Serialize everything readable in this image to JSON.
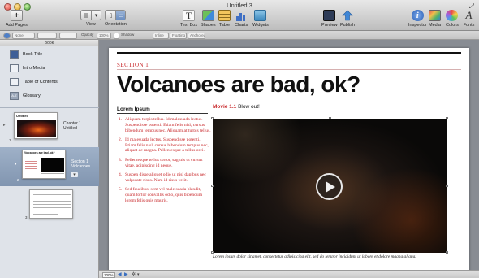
{
  "window": {
    "title": "Untitled 3"
  },
  "toolbar": {
    "add_pages": "Add Pages",
    "view": "View",
    "orientation": "Orientation",
    "text_box": "Text Box",
    "shapes": "Shapes",
    "table": "Table",
    "charts": "Charts",
    "widgets": "Widgets",
    "preview": "Preview",
    "publish": "Publish",
    "inspector": "Inspector",
    "media": "Media",
    "colors": "Colors",
    "fonts": "Fonts"
  },
  "formatbar": {
    "style": "None",
    "opacity_label": "Opacity",
    "opacity_value": "100%",
    "shadow_label": "Shadow",
    "inline": "Inline",
    "floating": "Floating",
    "anchored": "Anchored"
  },
  "sidebar": {
    "header": "Book",
    "items": [
      {
        "label": "Book Title"
      },
      {
        "label": "Intro Media"
      },
      {
        "label": "Table of Contents"
      },
      {
        "label": "Glossary"
      }
    ],
    "chapter": {
      "number": "1",
      "title": "Chapter 1",
      "subtitle": "Untitled",
      "thumb_title": "Untitled"
    },
    "section": {
      "number": "2",
      "title": "Section 1",
      "subtitle": "Volcanoes...",
      "thumb_title": "Volcanoes are bad, ok?"
    },
    "page3": {
      "number": "3"
    }
  },
  "page": {
    "section_label": "SECTION 1",
    "title": "Volcanoes are bad, ok?",
    "lorem_heading": "Lorem Ipsum",
    "list": [
      "Aliquam turpis tellus. Id malesuada lectus. Suspendisse potenti. Etiam felis nisl, cursus bibendum tempus nec. Aliquam at turpis tellus.",
      "Id malesuada lectus. Suspendisse potenti. Etiam felis nisl, cursus bibendum tempus nec, aliquet ac magna. Pellentesque a tellus orci.",
      "Pellentesque tellus tortor, sagittis ut cursus vitae, adipiscing id neque.",
      "Suspen disse aliquet odio ut nisl dapibus nec vulputate risus. Nam id risus velit.",
      "Sed faucibus, sem vel male suada blandit, quam tortor convallis odio, quis bibendum lorem felis quis mauris."
    ],
    "movie_label": "Movie 1.1",
    "movie_caption": "Blow out!",
    "body_caption": "Lorem ipsum dolor sit amet, consectetur adipisicing elit, sed do tempor incididunt ut labore et dolore magna aliqua."
  },
  "statusbar": {
    "zoom": "100%"
  },
  "colors": {
    "accent_red": "#c8282b",
    "selection": "#8ea2bd"
  }
}
